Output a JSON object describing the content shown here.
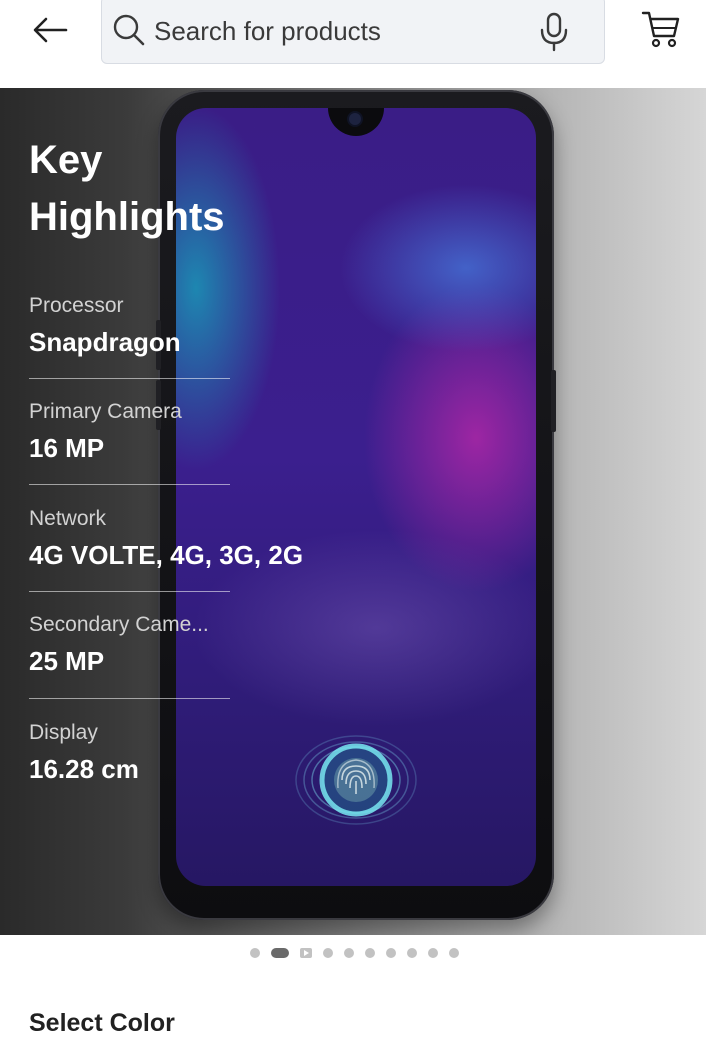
{
  "header": {
    "back_icon": "arrow-left-icon",
    "search": {
      "placeholder": "Search for products",
      "value": "",
      "search_icon": "magnifier-icon",
      "mic_icon": "microphone-icon"
    },
    "cart_icon": "cart-icon"
  },
  "hero": {
    "title_line1": "Key",
    "title_line2": "Highlights",
    "highlights": [
      {
        "label": "Processor",
        "value": "Snapdragon"
      },
      {
        "label": "Primary Camera",
        "value": "16 MP"
      },
      {
        "label": "Network",
        "value": "4G VOLTE, 4G, 3G, 2G"
      },
      {
        "label": "Secondary Came...",
        "value": "25 MP"
      },
      {
        "label": "Display",
        "value": "16.28 cm"
      }
    ]
  },
  "pager": {
    "total_items": 10,
    "active_index": 1,
    "video_index": 2
  },
  "sections": {
    "select_color_label": "Select Color"
  },
  "colors": {
    "text_primary": "#212121",
    "search_bg": "#f1f3f6",
    "pager_active": "#6a6a6a",
    "pager_inactive": "#c2c2c2"
  }
}
